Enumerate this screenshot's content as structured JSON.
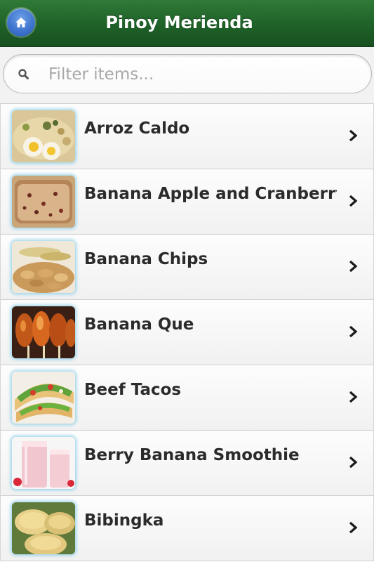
{
  "header": {
    "title": "Pinoy Merienda",
    "home_icon": "home-icon",
    "background": "#1f6128"
  },
  "search": {
    "placeholder": "Filter items...",
    "value": "",
    "icon": "search-icon"
  },
  "list": {
    "chevron_icon": "chevron-right-icon",
    "items": [
      {
        "label": "Arroz Caldo",
        "thumb": "arroz-caldo-thumbnail"
      },
      {
        "label": "Banana Apple and Cranberry",
        "thumb": "banana-apple-cranberry-thumbnail"
      },
      {
        "label": "Banana Chips",
        "thumb": "banana-chips-thumbnail"
      },
      {
        "label": "Banana Que",
        "thumb": "banana-que-thumbnail"
      },
      {
        "label": "Beef Tacos",
        "thumb": "beef-tacos-thumbnail"
      },
      {
        "label": "Berry Banana Smoothie",
        "thumb": "berry-banana-smoothie-thumbnail"
      },
      {
        "label": "Bibingka",
        "thumb": "bibingka-thumbnail"
      }
    ]
  }
}
